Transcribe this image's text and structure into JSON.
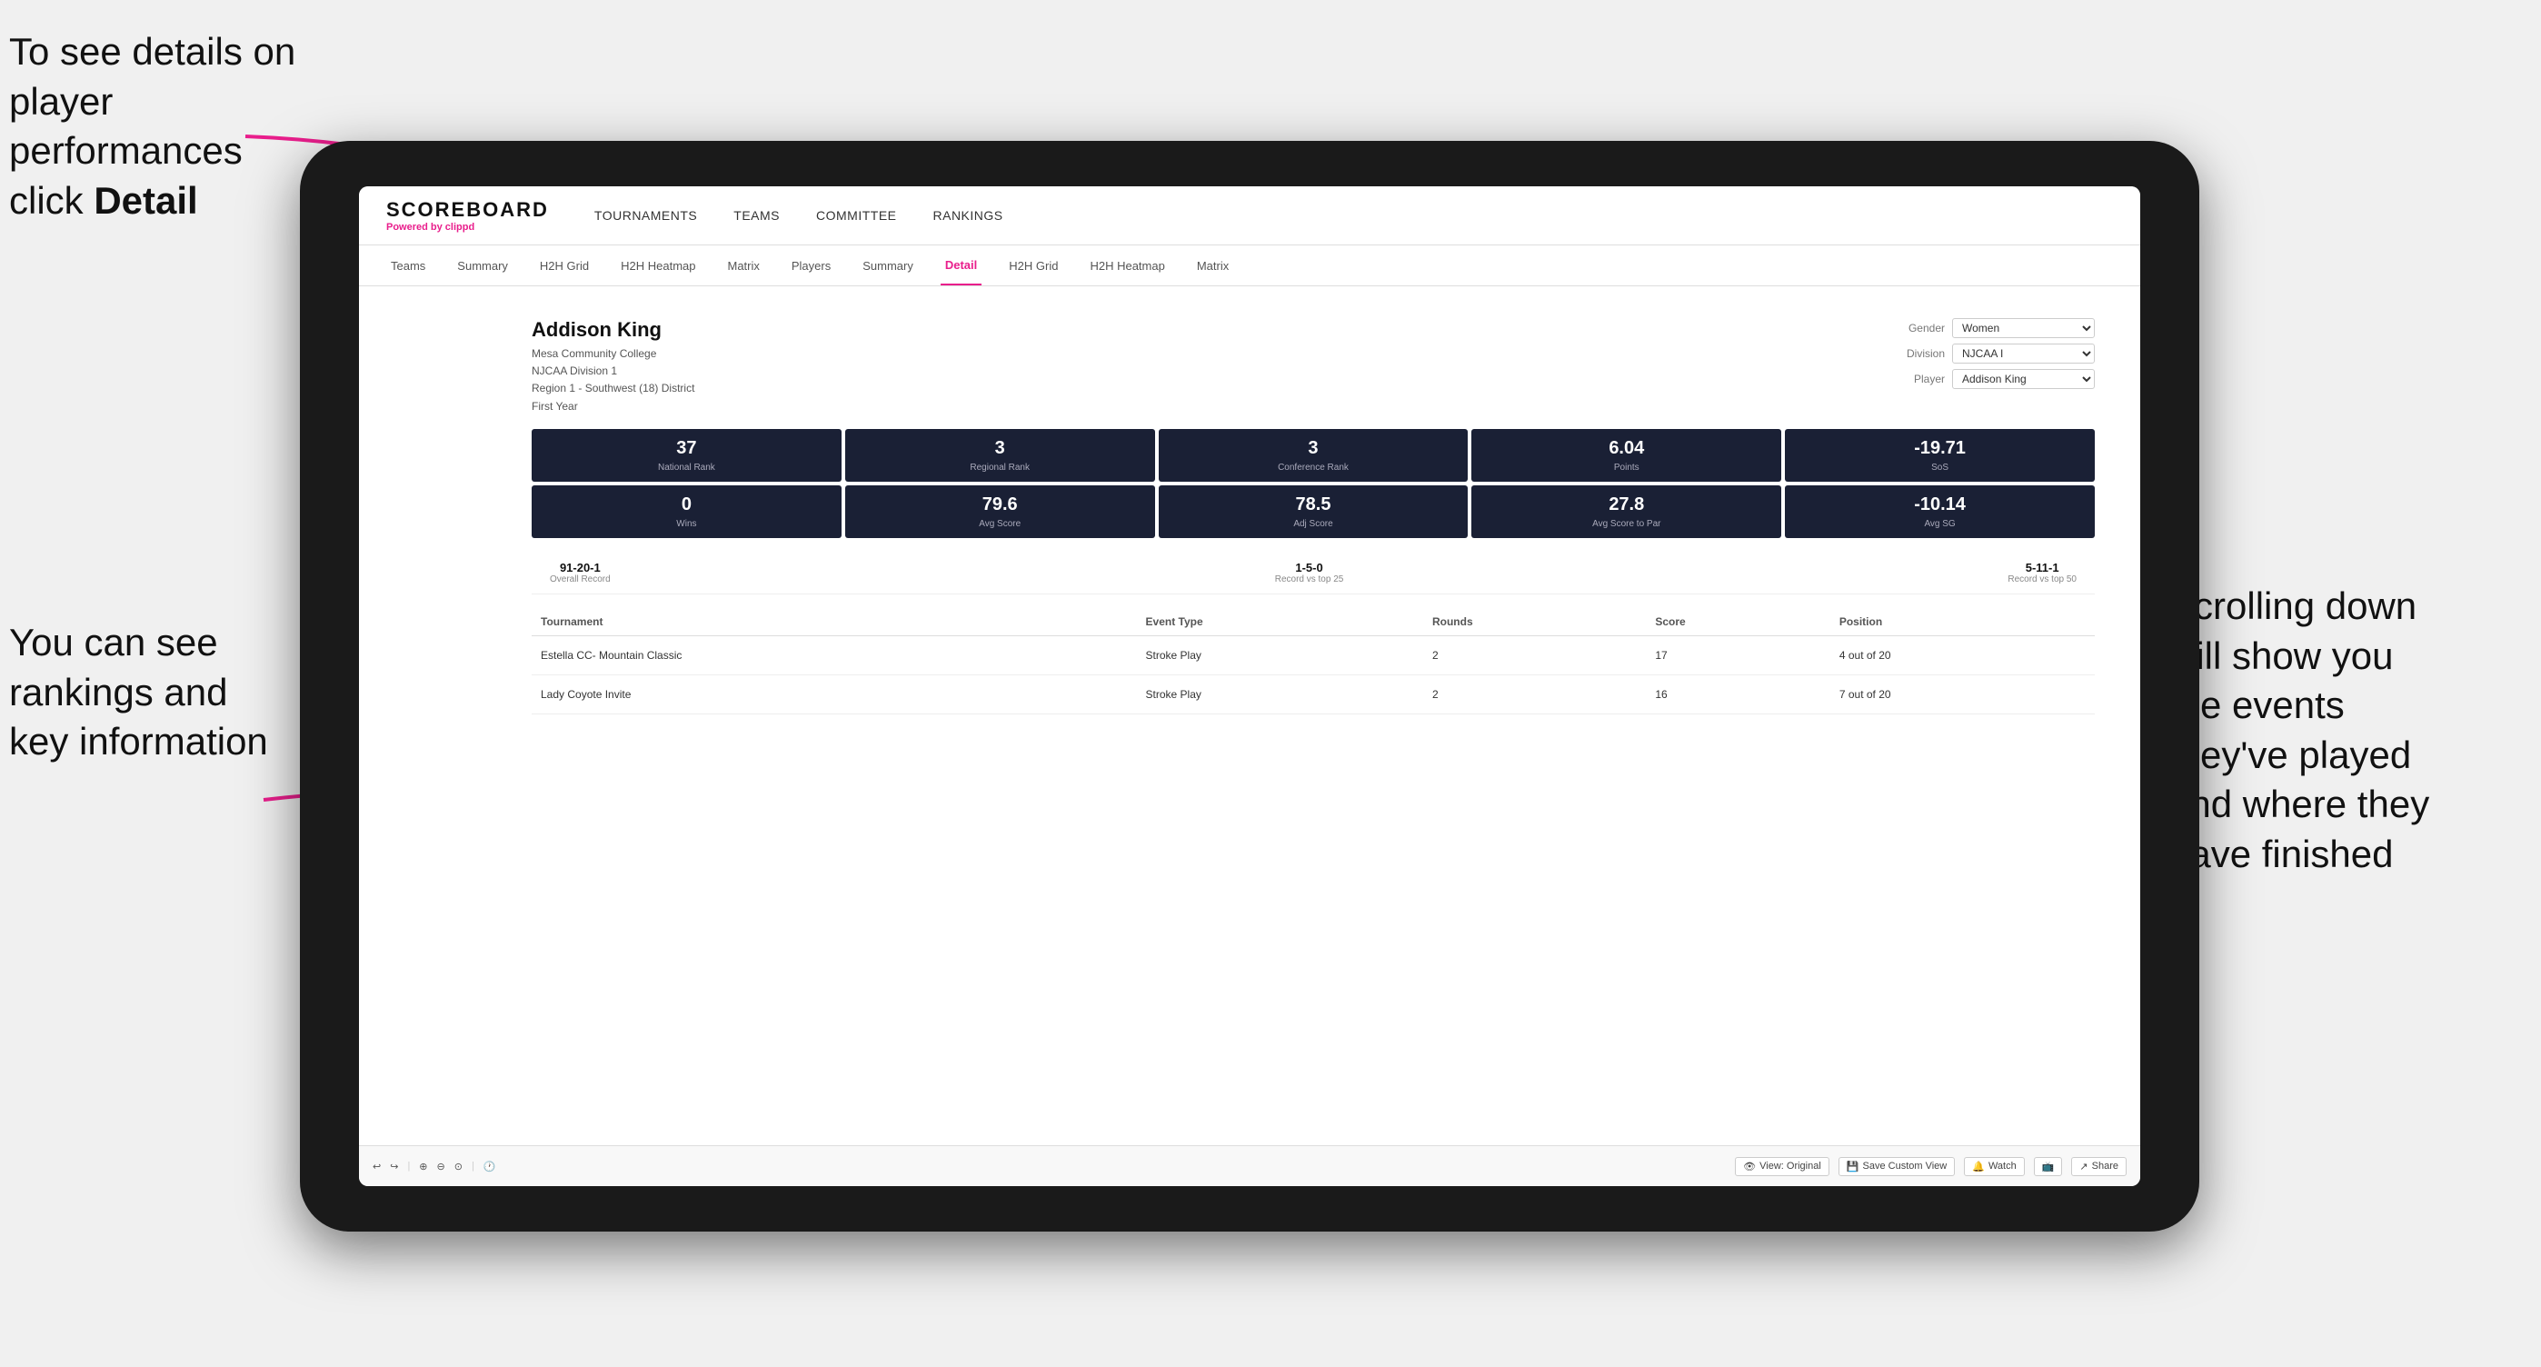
{
  "annotations": {
    "topleft_line1": "To see details on",
    "topleft_line2": "player performances",
    "topleft_line3": "click ",
    "topleft_bold": "Detail",
    "bottomleft_line1": "You can see",
    "bottomleft_line2": "rankings and",
    "bottomleft_line3": "key information",
    "right_line1": "Scrolling down",
    "right_line2": "will show you",
    "right_line3": "the events",
    "right_line4": "they've played",
    "right_line5": "and where they",
    "right_line6": "have finished"
  },
  "nav": {
    "logo": "SCOREBOARD",
    "powered_by": "Powered by ",
    "brand": "clippd",
    "items": [
      {
        "label": "TOURNAMENTS",
        "active": false
      },
      {
        "label": "TEAMS",
        "active": false
      },
      {
        "label": "COMMITTEE",
        "active": false
      },
      {
        "label": "RANKINGS",
        "active": false
      }
    ]
  },
  "sub_nav": {
    "items": [
      {
        "label": "Teams",
        "active": false
      },
      {
        "label": "Summary",
        "active": false
      },
      {
        "label": "H2H Grid",
        "active": false
      },
      {
        "label": "H2H Heatmap",
        "active": false
      },
      {
        "label": "Matrix",
        "active": false
      },
      {
        "label": "Players",
        "active": false
      },
      {
        "label": "Summary",
        "active": false
      },
      {
        "label": "Detail",
        "active": true
      },
      {
        "label": "H2H Grid",
        "active": false
      },
      {
        "label": "H2H Heatmap",
        "active": false
      },
      {
        "label": "Matrix",
        "active": false
      }
    ]
  },
  "player": {
    "name": "Addison King",
    "school": "Mesa Community College",
    "division": "NJCAA Division 1",
    "region": "Region 1 - Southwest (18) District",
    "year": "First Year",
    "gender_label": "Gender",
    "gender_value": "Women",
    "division_label": "Division",
    "division_value": "NJCAA I",
    "player_label": "Player",
    "player_value": "Addison King"
  },
  "stats": [
    {
      "value": "37",
      "label": "National Rank"
    },
    {
      "value": "3",
      "label": "Regional Rank"
    },
    {
      "value": "3",
      "label": "Conference Rank"
    },
    {
      "value": "6.04",
      "label": "Points"
    },
    {
      "value": "-19.71",
      "label": "SoS"
    }
  ],
  "stats2": [
    {
      "value": "0",
      "label": "Wins"
    },
    {
      "value": "79.6",
      "label": "Avg Score"
    },
    {
      "value": "78.5",
      "label": "Adj Score"
    },
    {
      "value": "27.8",
      "label": "Avg Score to Par"
    },
    {
      "value": "-10.14",
      "label": "Avg SG"
    }
  ],
  "records": [
    {
      "value": "91-20-1",
      "label": "Overall Record"
    },
    {
      "value": "1-5-0",
      "label": "Record vs top 25"
    },
    {
      "value": "5-11-1",
      "label": "Record vs top 50"
    }
  ],
  "table": {
    "headers": [
      "Tournament",
      "Event Type",
      "Rounds",
      "Score",
      "Position"
    ],
    "rows": [
      {
        "tournament": "Estella CC- Mountain Classic",
        "event_type": "Stroke Play",
        "rounds": "2",
        "score": "17",
        "position": "4 out of 20"
      },
      {
        "tournament": "Lady Coyote Invite",
        "event_type": "Stroke Play",
        "rounds": "2",
        "score": "16",
        "position": "7 out of 20"
      }
    ]
  },
  "toolbar": {
    "view_label": "View: Original",
    "save_label": "Save Custom View",
    "watch_label": "Watch",
    "share_label": "Share"
  }
}
